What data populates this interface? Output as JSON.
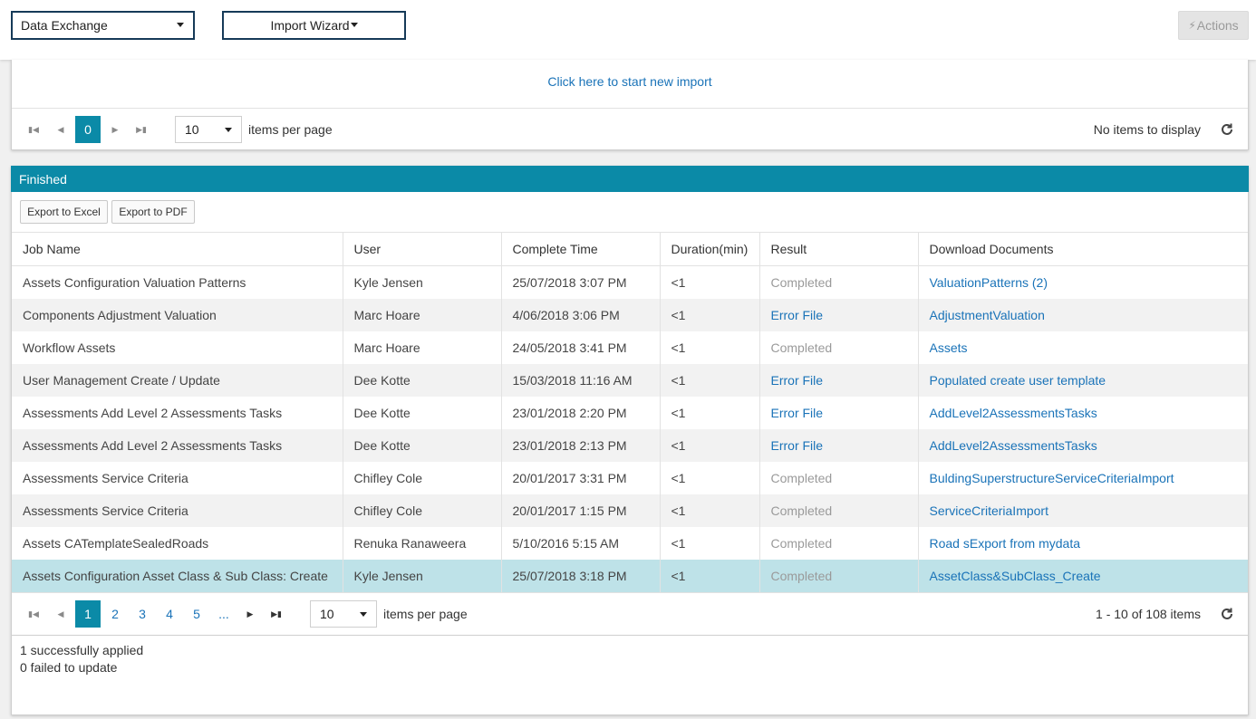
{
  "header": {
    "module_select": "Data Exchange",
    "wizard_label": "Import Wizard",
    "actions_label": "Actions"
  },
  "pending": {
    "start_link": "Click here to start new import",
    "pager": {
      "current": "0",
      "per_page": "10",
      "per_page_label": "items per page",
      "info": "No items to display"
    }
  },
  "finished": {
    "title": "Finished",
    "export_excel": "Export to Excel",
    "export_pdf": "Export to PDF",
    "columns": [
      "Job Name",
      "User",
      "Complete Time",
      "Duration(min)",
      "Result",
      "Download Documents"
    ],
    "rows": [
      {
        "job": "Assets Configuration Valuation Patterns",
        "user": "Kyle Jensen",
        "time": "25/07/2018 3:07 PM",
        "duration": "<1",
        "result": "Completed",
        "doc": "ValuationPatterns (2)"
      },
      {
        "job": "Components Adjustment Valuation",
        "user": "Marc Hoare",
        "time": "4/06/2018 3:06 PM",
        "duration": "<1",
        "result": "Error File",
        "doc": "AdjustmentValuation"
      },
      {
        "job": "Workflow Assets",
        "user": "Marc Hoare",
        "time": "24/05/2018 3:41 PM",
        "duration": "<1",
        "result": "Completed",
        "doc": "Assets"
      },
      {
        "job": "User Management Create / Update",
        "user": "Dee Kotte",
        "time": "15/03/2018 11:16 AM",
        "duration": "<1",
        "result": "Error File",
        "doc": "Populated create user template"
      },
      {
        "job": "Assessments Add Level 2 Assessments Tasks",
        "user": "Dee Kotte",
        "time": "23/01/2018 2:20 PM",
        "duration": "<1",
        "result": "Error File",
        "doc": "AddLevel2AssessmentsTasks"
      },
      {
        "job": "Assessments Add Level 2 Assessments Tasks",
        "user": "Dee Kotte",
        "time": "23/01/2018 2:13 PM",
        "duration": "<1",
        "result": "Error File",
        "doc": "AddLevel2AssessmentsTasks"
      },
      {
        "job": "Assessments Service Criteria",
        "user": "Chifley Cole",
        "time": "20/01/2017 3:31 PM",
        "duration": "<1",
        "result": "Completed",
        "doc": "BuldingSuperstructureServiceCriteriaImport"
      },
      {
        "job": "Assessments Service Criteria",
        "user": "Chifley Cole",
        "time": "20/01/2017 1:15 PM",
        "duration": "<1",
        "result": "Completed",
        "doc": "ServiceCriteriaImport"
      },
      {
        "job": "Assets CATemplateSealedRoads",
        "user": "Renuka Ranaweera",
        "time": "5/10/2016 5:15 AM",
        "duration": "<1",
        "result": "Completed",
        "doc": "Road sExport from mydata"
      },
      {
        "job": "Assets Configuration Asset Class & Sub Class: Create",
        "user": "Kyle Jensen",
        "time": "25/07/2018 3:18 PM",
        "duration": "<1",
        "result": "Completed",
        "doc": "AssetClass&SubClass_Create"
      }
    ],
    "selected_row": 9,
    "pager": {
      "pages": [
        "1",
        "2",
        "3",
        "4",
        "5",
        "..."
      ],
      "per_page": "10",
      "per_page_label": "items per page",
      "info": "1 - 10 of 108 items"
    }
  },
  "status": {
    "applied": "1 successfully applied",
    "failed": "0 failed to update"
  },
  "colors": {
    "accent": "#0b8aa7",
    "link": "#1a73b8",
    "selected_row": "#bee2e8"
  }
}
